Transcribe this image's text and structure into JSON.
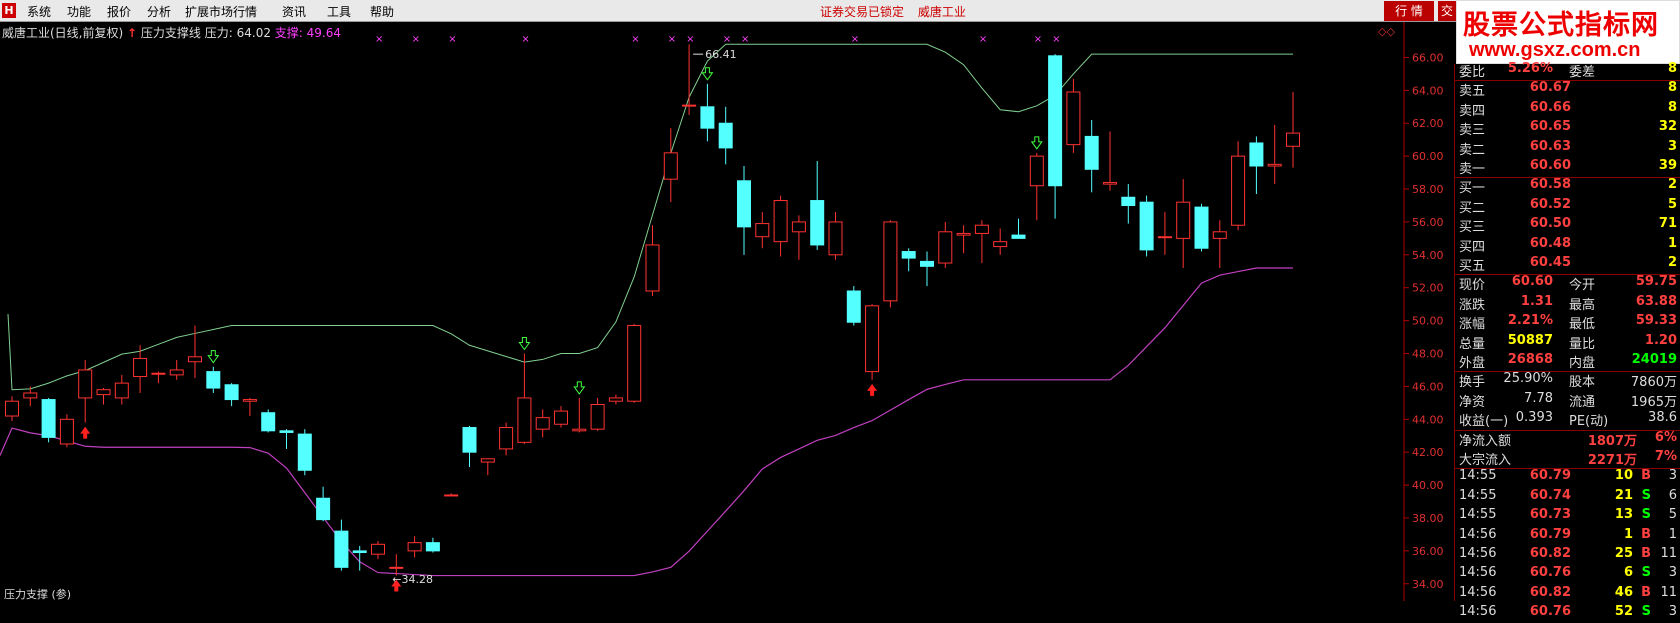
{
  "menubar": {
    "items": [
      "系统",
      "功能",
      "报价",
      "分析",
      "扩展市场行情",
      "资讯",
      "工具",
      "帮助"
    ],
    "status": [
      "证券交易已锁定",
      "威唐工业"
    ],
    "hq_label": "行 情",
    "hq2_label": "交"
  },
  "watermark": {
    "title": "股票公式指标网",
    "url": "www.gsxz.com.cn"
  },
  "chart_header": {
    "stock": "威唐工业(日线,前复权)",
    "indicator": "压力支撑线",
    "pressure_label": "压力: 64.02",
    "support_label": "支撑: 49.64"
  },
  "chart_data": {
    "type": "candlestick",
    "ylim": [
      33.5,
      67
    ],
    "yticks": [
      "66.00",
      "64.00",
      "62.00",
      "60.00",
      "58.00",
      "56.00",
      "54.00",
      "52.00",
      "50.00",
      "48.00",
      "46.00",
      "44.00",
      "42.00",
      "40.00",
      "38.00",
      "36.00",
      "34.00"
    ],
    "candles": [
      [
        44.2,
        45.4,
        43.9,
        45.1
      ],
      [
        45.3,
        46.0,
        44.8,
        45.6
      ],
      [
        45.2,
        45.3,
        42.6,
        42.9
      ],
      [
        42.5,
        44.3,
        42.3,
        44.0
      ],
      [
        45.3,
        47.6,
        43.8,
        47.0
      ],
      [
        45.5,
        45.9,
        44.9,
        45.8
      ],
      [
        45.3,
        46.7,
        44.9,
        46.2
      ],
      [
        46.6,
        48.5,
        45.6,
        47.7
      ],
      [
        46.8,
        46.9,
        46.2,
        46.8
      ],
      [
        46.7,
        47.6,
        46.4,
        47.0
      ],
      [
        47.5,
        49.7,
        46.5,
        47.8
      ],
      [
        46.9,
        47.2,
        45.6,
        45.9
      ],
      [
        46.1,
        46.2,
        44.8,
        45.2
      ],
      [
        45.1,
        45.3,
        44.2,
        45.2
      ],
      [
        44.4,
        44.6,
        43.2,
        43.3
      ],
      [
        43.3,
        43.4,
        42.2,
        43.2
      ],
      [
        43.1,
        43.4,
        40.6,
        40.9
      ],
      [
        39.2,
        39.9,
        37.8,
        37.9
      ],
      [
        37.2,
        37.9,
        34.8,
        35.0
      ],
      [
        36.0,
        36.3,
        34.8,
        35.9
      ],
      [
        35.8,
        36.6,
        35.5,
        36.4
      ],
      [
        35.0,
        35.8,
        34.5,
        35.0
      ],
      [
        36.0,
        36.9,
        35.6,
        36.5
      ],
      [
        36.5,
        36.8,
        35.9,
        36.0
      ],
      [
        39.4,
        39.5,
        39.4,
        39.4
      ],
      [
        43.5,
        43.6,
        41.1,
        42.0
      ],
      [
        41.4,
        41.5,
        40.6,
        41.6
      ],
      [
        42.2,
        43.8,
        41.8,
        43.5
      ],
      [
        42.6,
        48.0,
        42.5,
        45.3
      ],
      [
        43.4,
        44.6,
        42.9,
        44.1
      ],
      [
        43.7,
        44.8,
        43.5,
        44.5
      ],
      [
        43.3,
        45.3,
        43.2,
        43.4
      ],
      [
        43.4,
        45.3,
        43.3,
        44.9
      ],
      [
        45.1,
        45.5,
        44.9,
        45.3
      ],
      [
        45.1,
        49.8,
        45.0,
        49.7
      ],
      [
        51.8,
        55.8,
        51.5,
        54.6
      ],
      [
        58.6,
        61.7,
        57.2,
        60.2
      ],
      [
        63.1,
        66.8,
        62.5,
        63.1
      ],
      [
        63.0,
        64.4,
        60.9,
        61.7
      ],
      [
        62.0,
        63.0,
        59.5,
        60.5
      ],
      [
        58.5,
        59.4,
        54.0,
        55.7
      ],
      [
        55.1,
        56.6,
        54.4,
        55.9
      ],
      [
        54.8,
        57.6,
        53.9,
        57.3
      ],
      [
        55.4,
        56.4,
        53.7,
        56.0
      ],
      [
        57.3,
        59.7,
        54.3,
        54.6
      ],
      [
        54.0,
        56.6,
        53.7,
        56.0
      ],
      [
        51.8,
        52.1,
        49.7,
        49.9
      ],
      [
        46.9,
        51.0,
        46.4,
        50.9
      ],
      [
        51.2,
        56.1,
        50.8,
        56.0
      ],
      [
        54.2,
        54.4,
        53.0,
        53.8
      ],
      [
        53.6,
        54.2,
        52.1,
        53.3
      ],
      [
        53.5,
        56.0,
        53.2,
        55.4
      ],
      [
        55.2,
        55.8,
        54.1,
        55.3
      ],
      [
        55.3,
        56.1,
        53.5,
        55.8
      ],
      [
        54.5,
        55.6,
        54.0,
        54.8
      ],
      [
        55.2,
        56.2,
        55.0,
        55.0
      ],
      [
        58.2,
        60.2,
        56.1,
        60.0
      ],
      [
        66.1,
        66.2,
        56.2,
        58.2
      ],
      [
        60.7,
        64.7,
        60.2,
        63.9
      ],
      [
        61.2,
        62.2,
        57.8,
        59.2
      ],
      [
        58.3,
        61.5,
        57.9,
        58.4
      ],
      [
        57.5,
        58.3,
        55.9,
        57.0
      ],
      [
        57.2,
        57.6,
        53.9,
        54.3
      ],
      [
        55.1,
        56.6,
        54.0,
        55.1
      ],
      [
        55.0,
        58.6,
        53.2,
        57.2
      ],
      [
        56.9,
        57.1,
        54.2,
        54.4
      ],
      [
        55.0,
        56.1,
        53.2,
        55.4
      ],
      [
        55.8,
        60.9,
        55.5,
        60.0
      ],
      [
        60.8,
        61.2,
        57.7,
        59.4
      ],
      [
        59.4,
        61.9,
        58.3,
        59.5
      ],
      [
        60.6,
        63.9,
        59.3,
        61.4
      ]
    ],
    "pressure_level": "64.02",
    "support_level": "49.64",
    "annotations": {
      "high_label": "66.41",
      "low_label": "34.28"
    }
  },
  "quote_panel": {
    "top_row": {
      "label": "委比",
      "value": "5.26%",
      "label2": "委差",
      "value2": "8"
    },
    "asks": [
      {
        "label": "卖五",
        "price": "60.67",
        "vol": "8"
      },
      {
        "label": "卖四",
        "price": "60.66",
        "vol": "8"
      },
      {
        "label": "卖三",
        "price": "60.65",
        "vol": "32"
      },
      {
        "label": "卖二",
        "price": "60.63",
        "vol": "3"
      },
      {
        "label": "卖一",
        "price": "60.60",
        "vol": "39"
      }
    ],
    "bids": [
      {
        "label": "买一",
        "price": "60.58",
        "vol": "2"
      },
      {
        "label": "买二",
        "price": "60.52",
        "vol": "5"
      },
      {
        "label": "买三",
        "price": "60.50",
        "vol": "71"
      },
      {
        "label": "买四",
        "price": "60.48",
        "vol": "1"
      },
      {
        "label": "买五",
        "price": "60.45",
        "vol": "2"
      }
    ],
    "stats": [
      {
        "l1": "现价",
        "v1": "60.60",
        "c1": "#ff4040",
        "l2": "今开",
        "v2": "59.75",
        "c2": "#ff4040"
      },
      {
        "l1": "涨跌",
        "v1": "1.31",
        "c1": "#ff4040",
        "l2": "最高",
        "v2": "63.88",
        "c2": "#ff4040"
      },
      {
        "l1": "涨幅",
        "v1": "2.21%",
        "c1": "#ff4040",
        "l2": "最低",
        "v2": "59.33",
        "c2": "#ff4040"
      },
      {
        "l1": "总量",
        "v1": "50887",
        "c1": "#ffff00",
        "l2": "量比",
        "v2": "1.20",
        "c2": "#ff4040"
      },
      {
        "l1": "外盘",
        "v1": "26868",
        "c1": "#ff4040",
        "l2": "内盘",
        "v2": "24019",
        "c2": "#00ff00"
      }
    ],
    "stats2": [
      {
        "l1": "换手",
        "v1": "25.90%",
        "l2": "股本",
        "v2": "7860万"
      },
      {
        "l1": "净资",
        "v1": "7.78",
        "l2": "流通",
        "v2": "1965万"
      },
      {
        "l1": "收益(一)",
        "v1": "0.393",
        "l2": "PE(动)",
        "v2": "38.6"
      }
    ],
    "flows": [
      {
        "label": "净流入额",
        "value": "1807万",
        "pct": "6%"
      },
      {
        "label": "大宗流入",
        "value": "2271万",
        "pct": "7%"
      }
    ],
    "ticks": [
      {
        "time": "14:55",
        "price": "60.79",
        "vol": "10",
        "bs": "B",
        "n": "3"
      },
      {
        "time": "14:55",
        "price": "60.74",
        "vol": "21",
        "bs": "S",
        "n": "6"
      },
      {
        "time": "14:55",
        "price": "60.73",
        "vol": "13",
        "bs": "S",
        "n": "5"
      },
      {
        "time": "14:56",
        "price": "60.79",
        "vol": "1",
        "bs": "B",
        "n": "1"
      },
      {
        "time": "14:56",
        "price": "60.82",
        "vol": "25",
        "bs": "B",
        "n": "11"
      },
      {
        "time": "14:56",
        "price": "60.76",
        "vol": "6",
        "bs": "S",
        "n": "3"
      },
      {
        "time": "14:56",
        "price": "60.82",
        "vol": "46",
        "bs": "B",
        "n": "11"
      },
      {
        "time": "14:56",
        "price": "60.76",
        "vol": "52",
        "bs": "S",
        "n": "3"
      }
    ]
  },
  "bottom_label": "压力支撑 (参)"
}
